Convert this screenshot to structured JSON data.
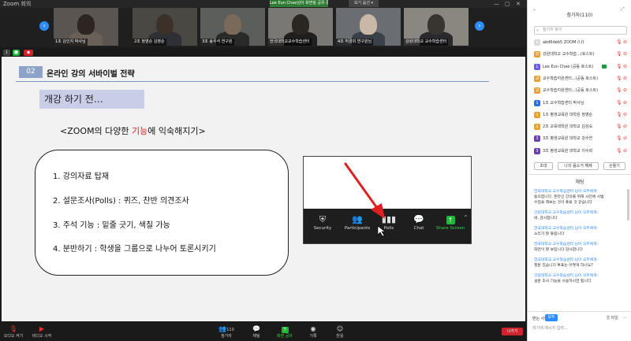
{
  "window": {
    "title": "Zoom 회의",
    "notice": "Lee Eun Chae님이 화면을 공유 중입니다",
    "view_button": "보기 옵션 ▾"
  },
  "participant_strip": {
    "tiles": [
      {
        "name": "1조 김인지 박사님"
      },
      {
        "name": "2조 정영순 김영순"
      },
      {
        "name": "3조 송우석 연구원"
      },
      {
        "name": "한국대학교교수학습센터"
      },
      {
        "name": "4조 허경미 연구원님"
      },
      {
        "name": "강원대학교 교수학습센터"
      }
    ]
  },
  "slide": {
    "section_number": "02",
    "section_title": "온라인 강의 서바이벌 전략",
    "banner": "개강 하기 전…",
    "subtitle_pre": "<ZOOM의 다양한 ",
    "subtitle_highlight": "기능",
    "subtitle_post": "에 익숙해지기>",
    "list": [
      "1. 강의자료 탑재",
      "2. 설문조사(Polls) : 퀴즈, 찬반 의견조사",
      "3. 주석 기능 :  밑줄 긋기, 색칠 가능",
      "4. 분반하기 : 학생을 그룹으로 나누어 토론시키기"
    ],
    "zoom_toolbar": [
      {
        "label": "Security",
        "icon": "shield-icon"
      },
      {
        "label": "Participants",
        "icon": "people-icon"
      },
      {
        "label": "Polls",
        "icon": "bar-chart-icon"
      },
      {
        "label": "Chat",
        "icon": "chat-bubble-icon"
      },
      {
        "label": "Share Screen",
        "icon": "share-up-arrow-icon"
      }
    ],
    "arrow_color": "#e02020"
  },
  "toolbar": {
    "mute": "오디오 켜기",
    "video": "비디오 시작",
    "participants": "참가자",
    "participants_count": "110",
    "chat": "채팅",
    "share": "화면 공유",
    "record": "기록",
    "reactions": "반응",
    "leave": "나가기"
  },
  "panel": {
    "title": "참가자(110)",
    "search_placeholder": "참가자 찾기",
    "participants": [
      {
        "name": "abd6deb5 ZOOM (나)",
        "avatar_color": "#d9d9d9",
        "initial": "a",
        "video": false
      },
      {
        "name": "강원대학교 교수학습...(호스트)",
        "avatar_color": "#e8a030",
        "initial": "강",
        "video": false
      },
      {
        "name": "Lee Eun Chae (공동 호스트)",
        "avatar_color": "#6c5ce7",
        "initial": "L",
        "video": true
      },
      {
        "name": "교수학습지원센터...(공동 호스트)",
        "avatar_color": "#e8a030",
        "initial": "교",
        "video": false
      },
      {
        "name": "교수학습지원센터...(공동 호스트)",
        "avatar_color": "#e8a030",
        "initial": "교",
        "video": false
      },
      {
        "name": "1조 교수학습센터 박사님",
        "avatar_color": "#2f6fd6",
        "initial": "1",
        "video": false
      },
      {
        "name": "1조 평생교육원 대학원 정영순",
        "avatar_color": "#e8a030",
        "initial": "1",
        "video": false
      },
      {
        "name": "2조 교육대학원 대학교 김성숙",
        "avatar_color": "#e8a030",
        "initial": "2",
        "video": false
      },
      {
        "name": "3조 평생교육원 대학교 강수연",
        "avatar_color": "#6c3fb0",
        "initial": "3",
        "video": false
      },
      {
        "name": "3조 평생교육원 대학교 이수희",
        "avatar_color": "#6c3fb0",
        "initial": "3",
        "video": false
      }
    ],
    "buttons": [
      "초대",
      "나의 음소거 해제",
      "손들기"
    ],
    "chat_title": "채팅",
    "messages": [
      {
        "from": "한국대학교 교수학습센터 님이 모두에게:",
        "lines": [
          "동의합니다. 온라인 강의를 위해 사전에 시범",
          "수업을 해보는 것이 좋을 것 같습니다"
        ]
      },
      {
        "from": "강원대학교 교수학습센터 님이 모두에게:",
        "lines": [
          "네, 감사합니다"
        ]
      },
      {
        "from": "한국대학교 교수학습센터 님이 모두에게:",
        "lines": [
          "소리가 잘 들립니다"
        ]
      },
      {
        "from": "한국대학교 교수학습센터 님이 모두에게:",
        "lines": [
          "화면이 잘 보입니다 감사합니다"
        ]
      },
      {
        "from": "한국대학교 교수학습센터 님이 모두에게:",
        "lines": [
          "질문 있습니다 투표는 어떻게 하나요?"
        ]
      },
      {
        "from": "강원대학교 교수학습센터 님이 모두에게:",
        "lines": [
          "설문 조사 기능을 사용하시면 됩니다"
        ]
      }
    ],
    "to_label": "받는 사람:",
    "to_value": "모두",
    "file_label": "파일",
    "input_placeholder": "여기에 메시지 입력..."
  }
}
